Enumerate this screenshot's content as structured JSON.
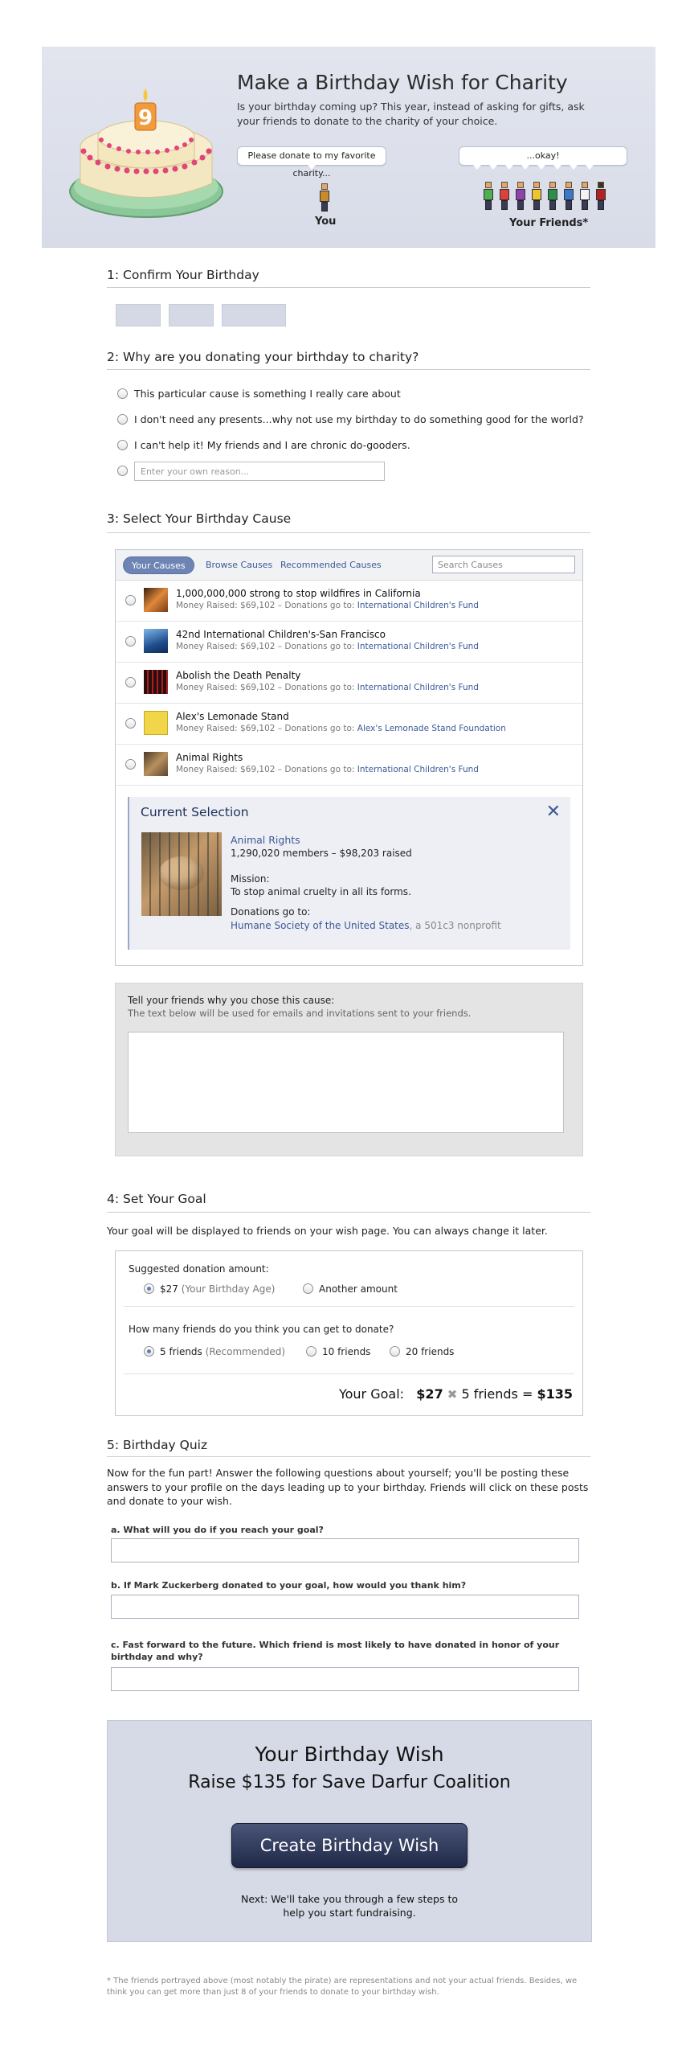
{
  "hero": {
    "title": "Make a Birthday Wish for Charity",
    "subtitle": "Is your birthday coming up? This year, instead of asking for gifts, ask your friends to donate to the charity of your choice.",
    "cake_number": "9",
    "you_bubble": "Please donate to my favorite charity...",
    "friends_bubble": "...okay!",
    "you_caption": "You",
    "friends_caption": "Your Friends*"
  },
  "section1": {
    "title": "1: Confirm Your Birthday"
  },
  "section2": {
    "title": "2: Why are you donating your birthday to charity?",
    "reasons": [
      "This particular cause is something I really care about",
      "I don't need any presents...why not use my birthday to do something good for the world?",
      "I can't help it! My friends and I are chronic do-gooders."
    ],
    "own_reason_placeholder": "Enter your own reason..."
  },
  "section3": {
    "title": "3: Select Your Birthday Cause",
    "tabs": [
      "Your Causes",
      "Browse Causes",
      "Recommended Causes"
    ],
    "search_placeholder": "Search Causes",
    "causes": [
      {
        "name": "1,000,000,000 strong to stop wildfires in California",
        "raised": "Money Raised: $69,102 – Donations go to:",
        "org": "International Children's Fund",
        "thumb": "wildfire-thumb",
        "color": "#c0713a"
      },
      {
        "name": "42nd International Children's-San Francisco",
        "raised": "Money Raised: $69,102 – Donations go to:",
        "org": "International Children's Fund",
        "thumb": "children-thumb",
        "color": "#3a6fb0"
      },
      {
        "name": "Abolish the Death Penalty",
        "raised": "Money Raised: $69,102 – Donations go to:",
        "org": "International Children's Fund",
        "thumb": "death-penalty-thumb",
        "color": "#6a1c1c"
      },
      {
        "name": "Alex's Lemonade Stand",
        "raised": "Money Raised: $69,102 – Donations go to:",
        "org": "Alex's Lemonade Stand Foundation",
        "thumb": "lemonade-thumb",
        "color": "#e8c93a"
      },
      {
        "name": "Animal Rights",
        "raised": "Money Raised: $69,102 – Donations go to:",
        "org": "International Children's Fund",
        "thumb": "animal-rights-thumb",
        "color": "#7a6040"
      }
    ],
    "current": {
      "heading": "Current Selection",
      "name": "Animal Rights",
      "stats": "1,290,020 members – $98,203 raised",
      "mission_label": "Mission:",
      "mission": "To stop animal cruelty in all its forms.",
      "donations_label": "Donations go to:",
      "org": "Humane Society of the United States",
      "org_suffix": ", a 501c3 nonprofit"
    },
    "tell_heading": "Tell your friends why you chose this cause:",
    "tell_sub": "The text below will be used for emails and invitations sent to your friends."
  },
  "section4": {
    "title": "4: Set Your Goal",
    "description": "Your goal will be displayed to friends on your wish page. You can always change it later.",
    "amount_question": "Suggested donation amount:",
    "amount_option_value": "$27",
    "amount_option_note": "(Your Birthday Age)",
    "amount_option_other": "Another amount",
    "friends_question": "How many friends do you think you can get to donate?",
    "friends_options": [
      {
        "label": "5 friends",
        "note": "(Recommended)"
      },
      {
        "label": "10 friends",
        "note": ""
      },
      {
        "label": "20 friends",
        "note": ""
      }
    ],
    "goal_label": "Your Goal:",
    "goal_amount": "$27",
    "goal_times": "✖",
    "goal_friends": "5 friends",
    "goal_equals": "=",
    "goal_total": "$135"
  },
  "section5": {
    "title": "5: Birthday Quiz",
    "intro": "Now for the fun part! Answer the following questions about yourself; you'll be posting these answers to your profile on the days leading up to your birthday. Friends will click on these posts and donate to your wish.",
    "questions": [
      "a. What will you do if you reach your goal?",
      "b. If Mark Zuckerberg donated to your goal, how would you thank him?",
      "c. Fast forward to the future. Which friend is most likely to have donated in honor of your birthday and why?"
    ]
  },
  "cta": {
    "heading": "Your Birthday Wish",
    "goal": "Raise $135 for Save Darfur Coalition",
    "button": "Create Birthday Wish",
    "next_line1": "Next: We'll take you through a few steps to",
    "next_line2": "help you start fundraising."
  },
  "footnote": "* The friends portrayed above (most notably the pirate) are representations and not your actual friends. Besides, we think you can get more than just 8 of your friends to donate to your birthday wish.",
  "colors": {
    "link": "#3b5998",
    "hero_bg": "#dde0ea",
    "cta_btn": "#2a3354",
    "radio_dot": "#6a79b8"
  }
}
